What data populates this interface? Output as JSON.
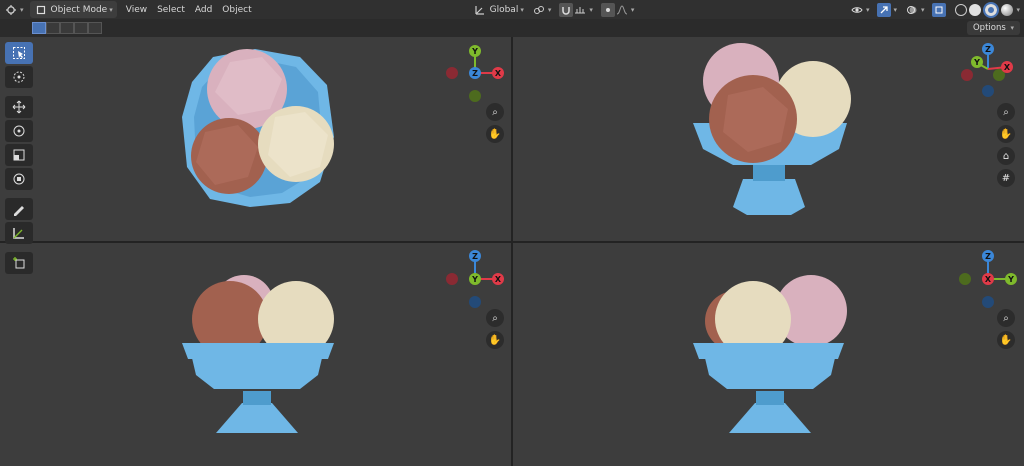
{
  "header": {
    "mode_label": "Object Mode",
    "menu": [
      "View",
      "Select",
      "Add",
      "Object"
    ],
    "orientation": "Global"
  },
  "subbar": {
    "options_label": "Options"
  },
  "gizmo_labels": {
    "x": "X",
    "y": "Y",
    "z": "Z"
  },
  "colors": {
    "x_axis": "#e03a48",
    "y_axis": "#7fba2c",
    "z_axis": "#3b87d8",
    "bowl": "#6fb7e6",
    "scoop_pink": "#d9b1be",
    "scoop_brown": "#a2614f",
    "scoop_cream": "#e6dcbf"
  },
  "icons": {
    "navigation": [
      "zoom-icon",
      "hand-pan-icon",
      "camera-icon",
      "grid-icon"
    ],
    "tools": [
      "select-box-icon",
      "cursor-icon",
      "move-icon",
      "rotate-icon",
      "scale-icon",
      "transform-icon",
      "annotate-icon",
      "measure-icon",
      "add-cube-icon"
    ]
  }
}
